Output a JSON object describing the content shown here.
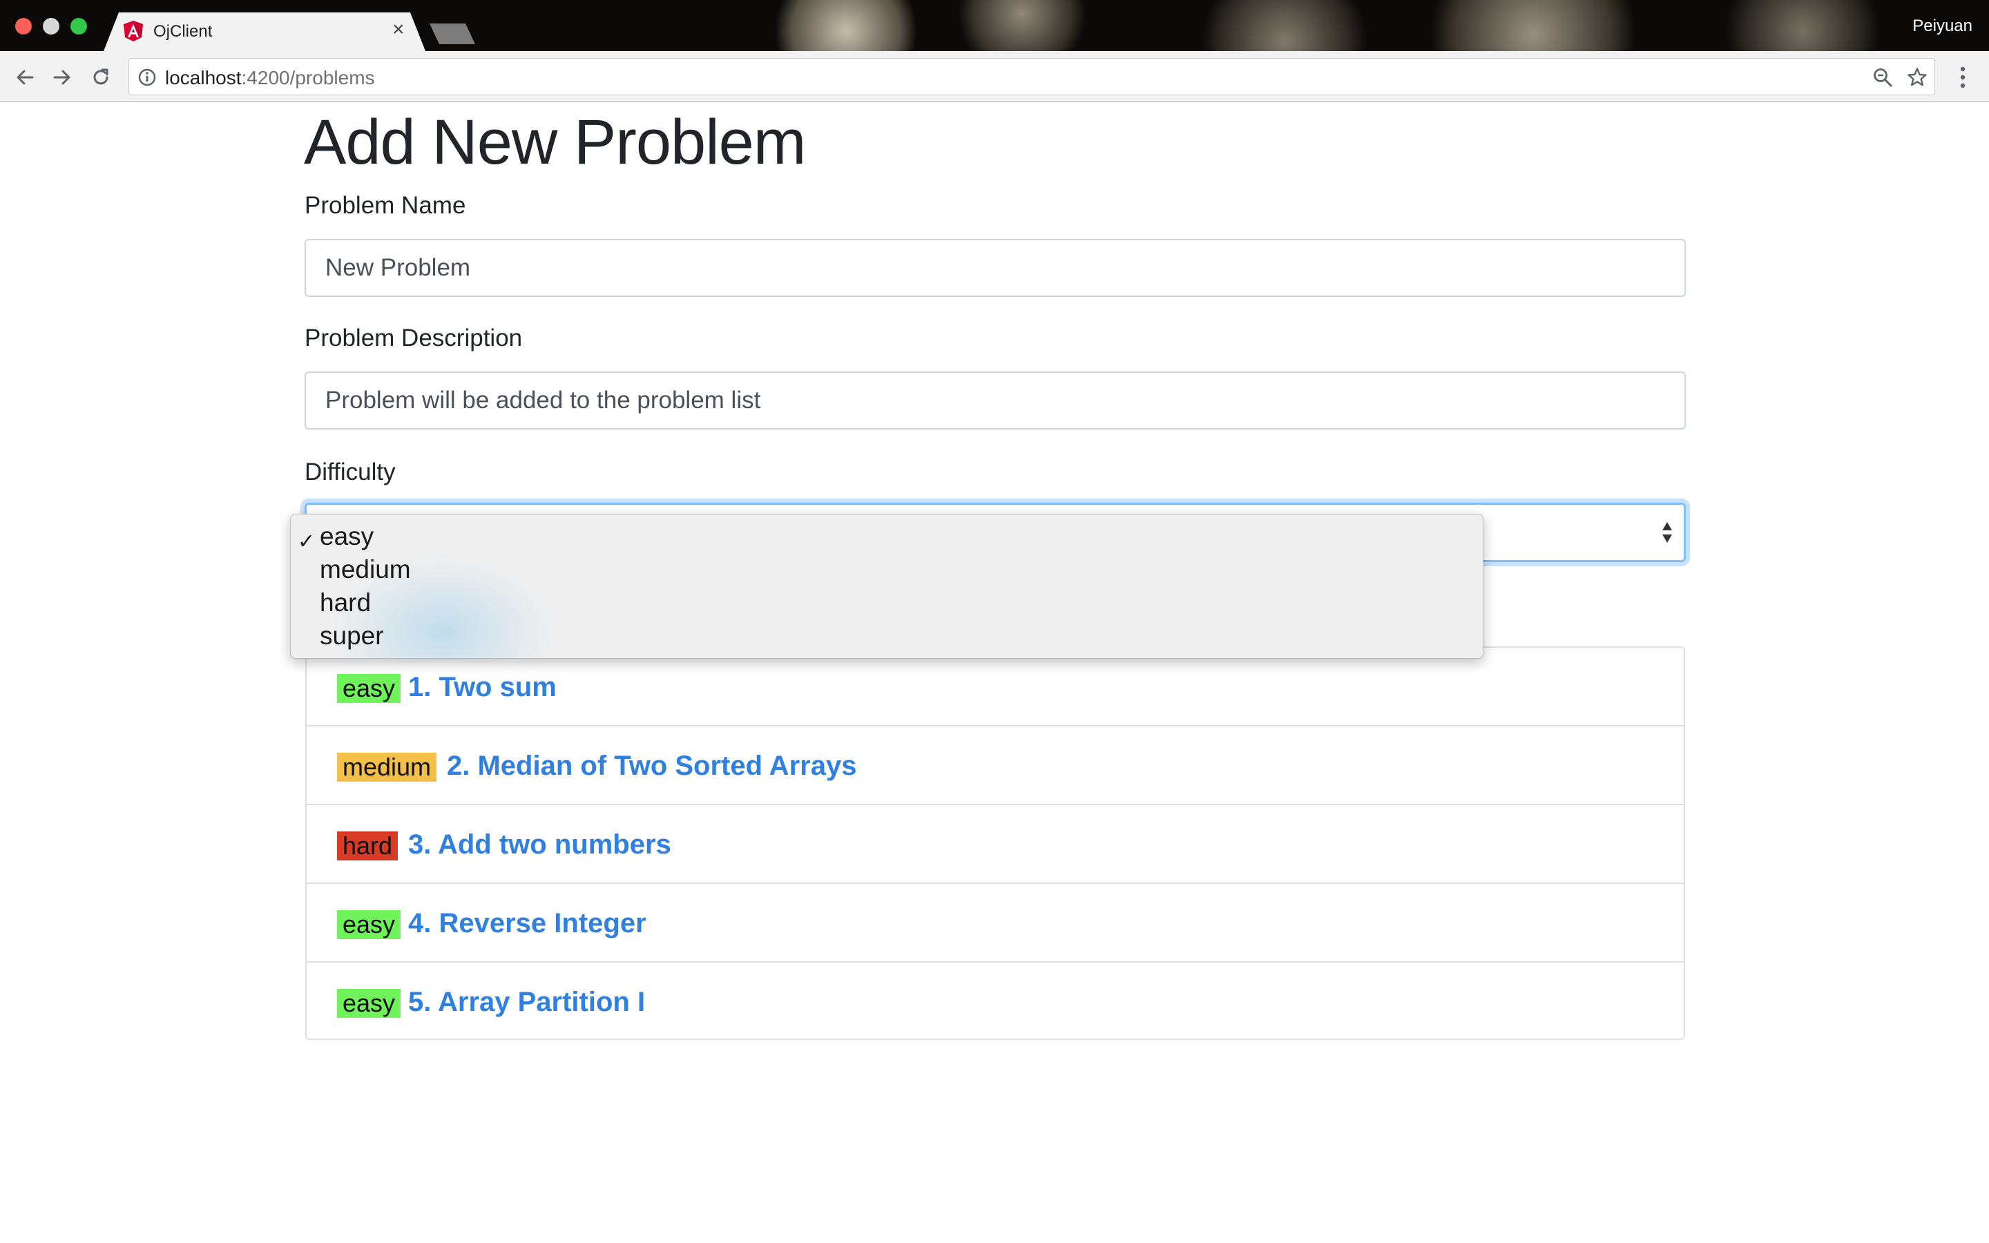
{
  "browser": {
    "tab_title": "OjClient",
    "tab_close": "×",
    "profile_name": "Peiyuan",
    "url_host": "localhost",
    "url_path": ":4200/problems"
  },
  "page": {
    "title": "Add New Problem"
  },
  "form": {
    "name_label": "Problem Name",
    "name_value": "New Problem",
    "description_label": "Problem Description",
    "description_value": "Problem will be added to the problem list",
    "difficulty_label": "Difficulty",
    "difficulty_selected": "easy",
    "difficulty_options": [
      "easy",
      "medium",
      "hard",
      "super"
    ]
  },
  "problems": [
    {
      "difficulty": "easy",
      "badge_color": "#6ff25a",
      "title": "1. Two sum"
    },
    {
      "difficulty": "medium",
      "badge_color": "#f3bf48",
      "title": "2. Median of Two Sorted Arrays"
    },
    {
      "difficulty": "hard",
      "badge_color": "#d73a27",
      "title": "3. Add two numbers"
    },
    {
      "difficulty": "easy",
      "badge_color": "#6ff25a",
      "title": "4. Reverse Integer"
    },
    {
      "difficulty": "easy",
      "badge_color": "#6ff25a",
      "title": "5. Array Partition I"
    }
  ],
  "colors": {
    "link": "#2f80e0",
    "focus_ring": "#80bdff"
  }
}
